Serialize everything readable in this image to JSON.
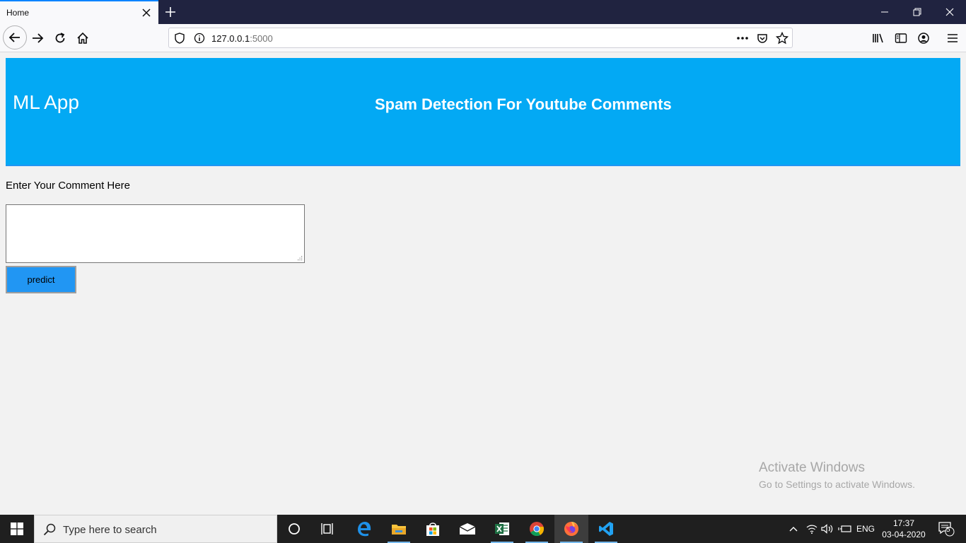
{
  "browser": {
    "tab_title": "Home",
    "url_host": "127.0.0.1",
    "url_port": ":5000"
  },
  "page": {
    "app_title": "ML App",
    "heading": "Spam Detection For Youtube Comments",
    "comment_label": "Enter Your Comment Here",
    "comment_value": "",
    "predict_label": "predict",
    "colors": {
      "header": "#03a9f4",
      "button": "#2196f3"
    }
  },
  "watermark": {
    "line1": "Activate Windows",
    "line2": "Go to Settings to activate Windows."
  },
  "taskbar": {
    "search_placeholder": "Type here to search",
    "apps": [
      "cortana-icon",
      "task-view-icon",
      "edge-icon",
      "file-explorer-icon",
      "store-icon",
      "mail-icon",
      "excel-icon",
      "chrome-icon",
      "firefox-icon",
      "vscode-icon"
    ],
    "lang": "ENG",
    "time": "17:37",
    "date": "03-04-2020",
    "notification_count": "5"
  }
}
